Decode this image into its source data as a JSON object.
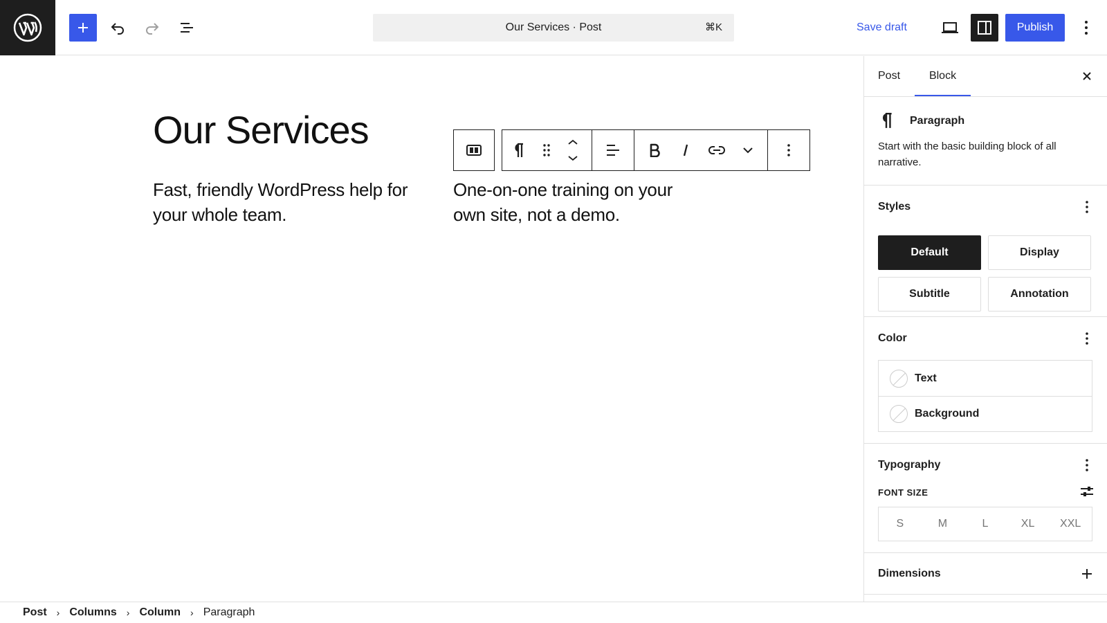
{
  "topbar": {
    "command_title": "Our Services · Post",
    "shortcut": "⌘K",
    "save_draft": "Save draft",
    "publish": "Publish"
  },
  "canvas": {
    "title": "Our Services",
    "columns": [
      "Fast, friendly WordPress help for your whole team.",
      "One-on-one training on your own site, not a demo."
    ]
  },
  "sidebar": {
    "tabs": {
      "post": "Post",
      "block": "Block"
    },
    "block_card": {
      "title": "Paragraph",
      "description": "Start with the basic building block of all narrative."
    },
    "styles": {
      "title": "Styles",
      "options": [
        "Default",
        "Display",
        "Subtitle",
        "Annotation"
      ]
    },
    "color": {
      "title": "Color",
      "items": [
        "Text",
        "Background"
      ]
    },
    "typography": {
      "title": "Typography",
      "font_size_label": "FONT SIZE",
      "sizes": [
        "S",
        "M",
        "L",
        "XL",
        "XXL"
      ]
    },
    "dimensions": {
      "title": "Dimensions"
    }
  },
  "breadcrumb": [
    "Post",
    "Columns",
    "Column",
    "Paragraph"
  ],
  "colors": {
    "accent": "#3858e9",
    "dark": "#1e1e1e"
  }
}
